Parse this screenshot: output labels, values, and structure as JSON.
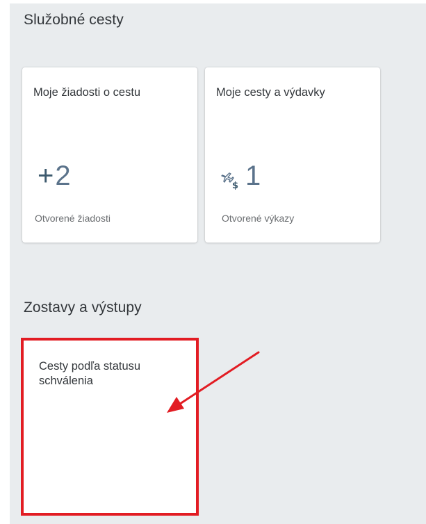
{
  "groups": [
    {
      "title": "Služobné cesty",
      "tiles": [
        {
          "title": "Moje žiadosti o cestu",
          "icon": "plus-icon",
          "kpi_symbol": "+",
          "kpi_value": "2",
          "footer": "Otvorené žiadosti"
        },
        {
          "title": "Moje cesty a výdavky",
          "icon": "travel-expense-icon",
          "kpi_value": "1",
          "footer": "Otvorené výkazy"
        }
      ]
    },
    {
      "title": "Zostavy a výstupy",
      "tiles": [
        {
          "title": "Cesty podľa statusu schválenia"
        }
      ]
    }
  ],
  "colors": {
    "page_background": "#e9ecee",
    "tile_background": "#ffffff",
    "highlight_border": "#e21c23",
    "annotation_arrow": "#e21c23",
    "kpi_value": "#5b738b"
  }
}
